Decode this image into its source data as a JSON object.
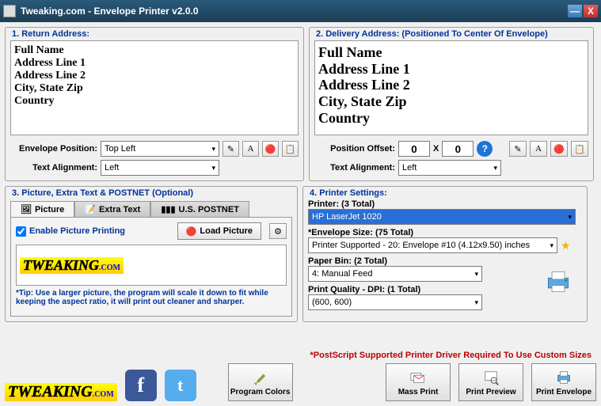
{
  "window": {
    "title": "Tweaking.com - Envelope Printer v2.0.0"
  },
  "returnAddress": {
    "legend": "1. Return Address:",
    "text": "Full Name\nAddress Line 1\nAddress Line 2\nCity, State Zip\nCountry",
    "envelopePositionLabel": "Envelope Position:",
    "envelopePositionValue": "Top Left",
    "textAlignLabel": "Text Alignment:",
    "textAlignValue": "Left"
  },
  "deliveryAddress": {
    "legend": "2. Delivery Address: (Positioned To Center Of Envelope)",
    "text": "Full Name\nAddress Line 1\nAddress Line 2\nCity, State Zip\nCountry",
    "positionOffsetLabel": "Position Offset:",
    "offsetX": "0",
    "xSep": "X",
    "offsetY": "0",
    "textAlignLabel": "Text Alignment:",
    "textAlignValue": "Left"
  },
  "pictureSection": {
    "legend": "3. Picture, Extra Text & POSTNET (Optional)",
    "tabs": {
      "picture": "Picture",
      "extraText": "Extra Text",
      "postnet": "U.S. POSTNET"
    },
    "enableLabel": "Enable Picture Printing",
    "loadPictureLabel": "Load Picture",
    "logoText": "TWEAKING",
    "logoCom": ".COM",
    "tip": "*Tip: Use a larger picture, the program will scale it down to fit while keeping the aspect ratio, it will print out cleaner and sharper."
  },
  "printerSettings": {
    "legend": "4. Printer Settings:",
    "printerLabel": "Printer: (3 Total)",
    "printerValue": "HP LaserJet 1020",
    "envelopeSizeLabel": "*Envelope Size: (75 Total)",
    "envelopeSizeValue": "Printer Supported - 20: Envelope #10 (4.12x9.50) inches",
    "paperBinLabel": "Paper Bin: (2 Total)",
    "paperBinValue": "4: Manual Feed",
    "qualityLabel": "Print Quality - DPI: (1 Total)",
    "qualityValue": "(600, 600)"
  },
  "footer": {
    "postscriptNote": "*PostScript Supported Printer Driver Required To Use Custom Sizes",
    "programColors": "Program Colors",
    "massPrint": "Mass Print",
    "printPreview": "Print Preview",
    "printEnvelope": "Print Envelope",
    "logoText": "TWEAKING",
    "logoCom": ".COM"
  }
}
